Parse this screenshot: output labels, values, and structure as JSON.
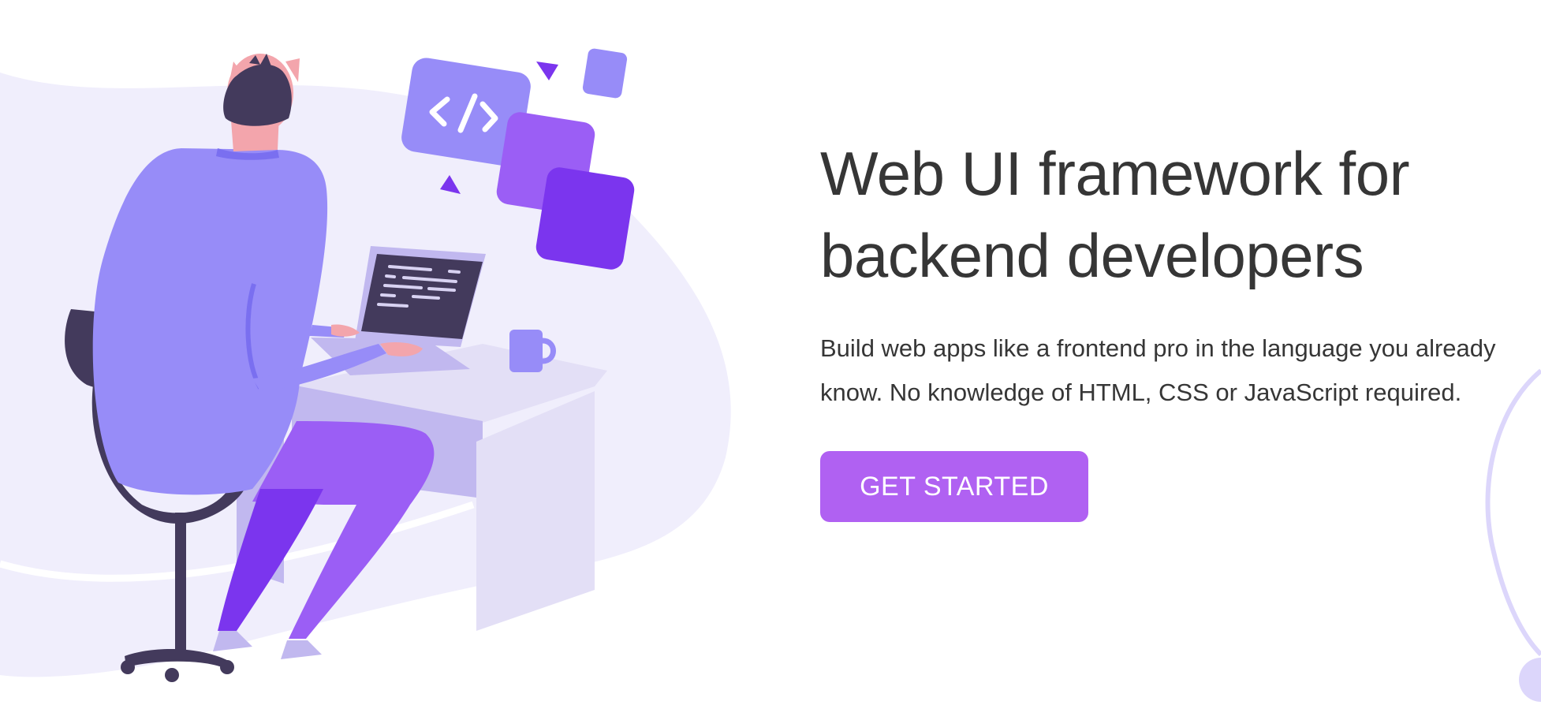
{
  "hero": {
    "headline": "Web UI framework for\nbackend developers",
    "subtitle": "Build web apps like a frontend pro in the language you already know. No knowledge of HTML, CSS or JavaScript required.",
    "cta_label": "GET STARTED"
  },
  "illustration": {
    "description_icons": [
      "developer-figure",
      "office-chair",
      "laptop",
      "desk",
      "coffee-mug",
      "code-bracket-icon",
      "floating-square",
      "floating-triangle"
    ]
  },
  "colors": {
    "accent": "#b061f2",
    "text": "#363636",
    "blob": "#f0eefc",
    "lavender": "#978cf8",
    "purple_dark": "#7b35ee",
    "purple_mid": "#9b5ef5",
    "navy": "#433a5c",
    "skin": "#f3a5ac",
    "desk_light": "#e3dff6",
    "desk_mid": "#c1b8ef"
  }
}
